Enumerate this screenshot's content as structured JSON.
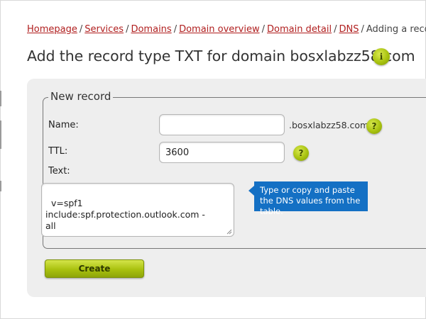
{
  "breadcrumb": {
    "links": [
      "Homepage",
      "Services",
      "Domains",
      "Domain overview",
      "Domain detail",
      "DNS"
    ],
    "separator": "/",
    "current": "Adding a record"
  },
  "header": {
    "title": "Add the record type TXT for domain bosxlabzz58.com",
    "info_icon": "i"
  },
  "form": {
    "legend": "New record",
    "name": {
      "label": "Name:",
      "value": "",
      "suffix": ".bosxlabzz58.com",
      "help": "?"
    },
    "ttl": {
      "label": "TTL:",
      "value": "3600",
      "help": "?"
    },
    "text": {
      "label": "Text:",
      "value": "v=spf1 include:spf.protection.outlook.com -\nall"
    },
    "create_label": "Create"
  },
  "callout": {
    "text": "Type or copy and paste the DNS values from the table."
  },
  "colors": {
    "breadcrumb_link": "#b01e1e",
    "callout_bg": "#1470c4",
    "button_green": "#a9c10f",
    "panel_bg": "#eeeeee"
  }
}
